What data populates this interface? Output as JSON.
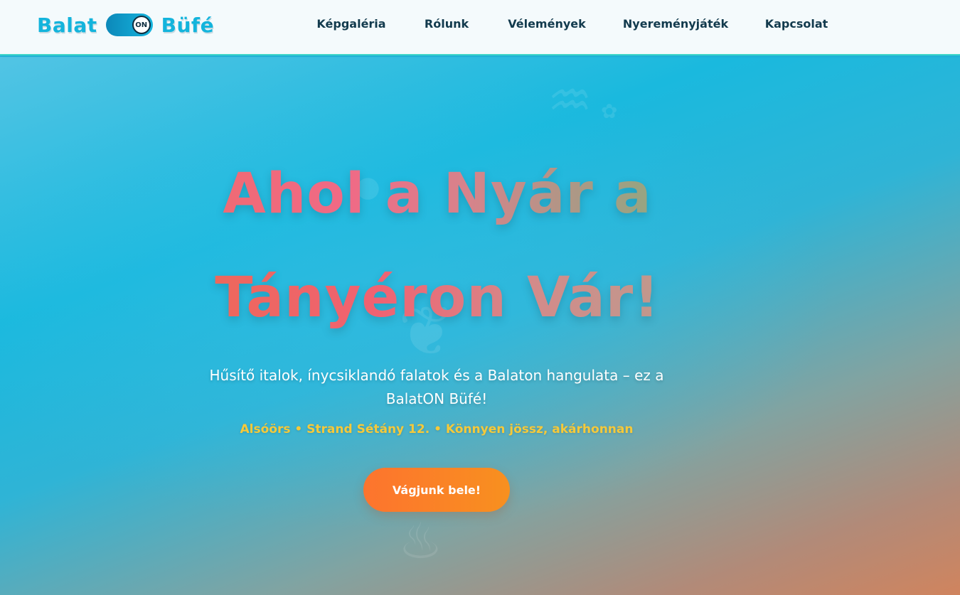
{
  "header": {
    "logo": {
      "left": "Balat",
      "toggle": "ON",
      "right": "Büfé"
    },
    "nav": [
      {
        "label": "Képgaléria"
      },
      {
        "label": "Rólunk"
      },
      {
        "label": "Vélemények"
      },
      {
        "label": "Nyereményjáték"
      },
      {
        "label": "Kapcsolat"
      }
    ]
  },
  "hero": {
    "headline_line1": "Ahol a Nyár a",
    "headline_line2": "Tányéron Vár!",
    "subtitle": "Hűsítő italok, ínycsiklandó falatok és a Balaton hangulata – ez a BalatON Büfé!",
    "address": "Alsóörs • Strand Sétány 12. • Könnyen jössz, akárhonnan",
    "cta_label": "Vágjunk bele!"
  },
  "colors": {
    "brand": "#13b4dc",
    "nav_text": "#123a4d",
    "accent_orange": "#fd742e",
    "address_yellow": "#f5c93a",
    "header_border": "#3fd6c9"
  }
}
